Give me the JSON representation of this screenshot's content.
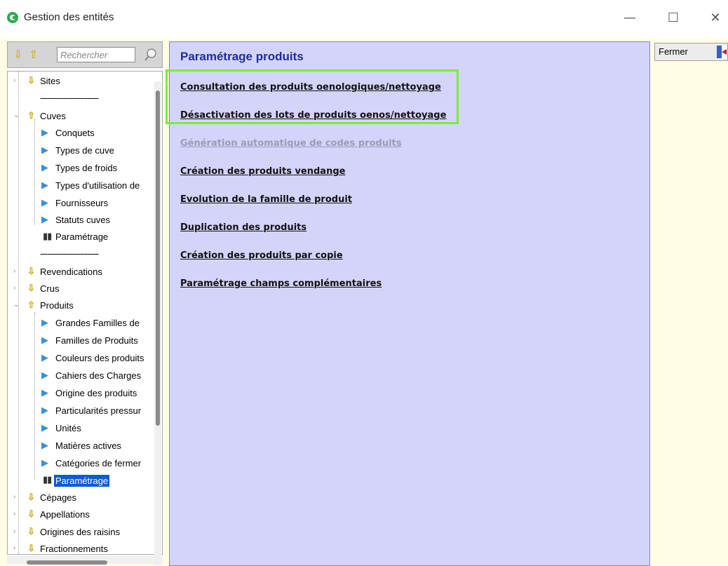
{
  "window": {
    "title": "Gestion des entités",
    "minimize": "—",
    "maximize": "☐",
    "close": "✕"
  },
  "search": {
    "placeholder": "Rechercher"
  },
  "tree": {
    "sites": "Sites",
    "separator": "-------------------------",
    "cuves": "Cuves",
    "cuves_children": [
      "Conquets",
      "Types de cuve",
      "Types de froids",
      "Types d'utilisation de",
      "Fournisseurs",
      "Statuts cuves",
      "Paramétrage"
    ],
    "revendications": "Revendications",
    "crus": "Crus",
    "produits": "Produits",
    "produits_children": [
      "Grandes Familles de",
      "Familles de Produits",
      "Couleurs des produits",
      "Cahiers des Charges",
      "Origine des produits",
      "Particularités pressur",
      "Unités",
      "Matières actives",
      "Catégories de fermer",
      "Paramétrage"
    ],
    "cepages": "Cépages",
    "appellations": "Appellations",
    "origines": "Origines des raisins",
    "fractionnements": "Fractionnements"
  },
  "main": {
    "title": "Paramétrage produits",
    "links": [
      {
        "label": "Consultation des produits oenologiques/nettoyage",
        "enabled": true
      },
      {
        "label": "Désactivation des lots de produits oenos/nettoyage",
        "enabled": true
      },
      {
        "label": "Génération automatique de codes produits",
        "enabled": false
      },
      {
        "label": "Création des produits vendange",
        "enabled": true
      },
      {
        "label": "Evolution de la famille de produit",
        "enabled": true
      },
      {
        "label": "Duplication des produits",
        "enabled": true
      },
      {
        "label": "Création des produits par copie",
        "enabled": true
      },
      {
        "label": "Paramétrage champs complémentaires",
        "enabled": true
      }
    ]
  },
  "fermer": {
    "label": "Fermer"
  },
  "colors": {
    "highlight": "#78ee3a",
    "panel_bg": "#d4d4fb",
    "title": "#1c2da0",
    "selection": "#0a5bd6"
  }
}
